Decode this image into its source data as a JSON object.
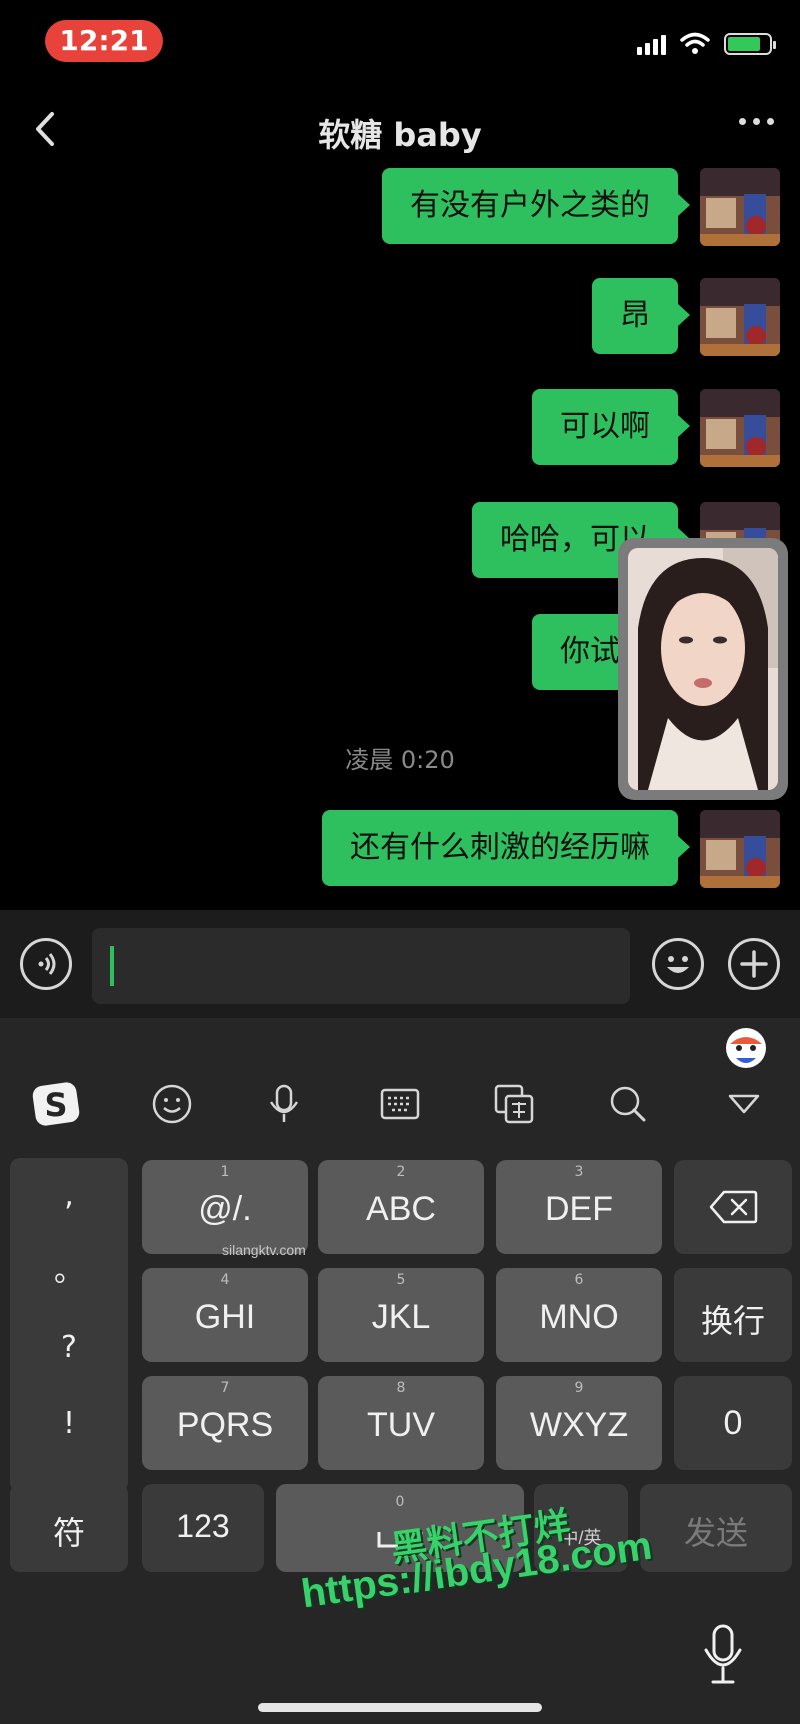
{
  "status_bar": {
    "time": "12:21"
  },
  "nav": {
    "title": "软糖 baby"
  },
  "messages": [
    {
      "text": "有没有户外之类的"
    },
    {
      "text": "昂"
    },
    {
      "text": "可以啊"
    },
    {
      "text": "哈哈，可以"
    },
    {
      "text": "你试过"
    },
    {
      "text": "还有什么刺激的经历嘛"
    }
  ],
  "timestamp": "凌晨 0:20",
  "input": {
    "value": ""
  },
  "keyboard": {
    "punctuation": [
      ",",
      "。",
      "?",
      "!"
    ],
    "keys_row1": [
      {
        "num": "1",
        "label": "@/."
      },
      {
        "num": "2",
        "label": "ABC"
      },
      {
        "num": "3",
        "label": "DEF"
      }
    ],
    "keys_row2": [
      {
        "num": "4",
        "label": "GHI"
      },
      {
        "num": "5",
        "label": "JKL"
      },
      {
        "num": "6",
        "label": "MNO"
      }
    ],
    "keys_row3": [
      {
        "num": "7",
        "label": "PQRS"
      },
      {
        "num": "8",
        "label": "TUV"
      },
      {
        "num": "9",
        "label": "WXYZ"
      }
    ],
    "newline_label": "换行",
    "zero_label": "0",
    "symbol_label": "符",
    "numeric_label": "123",
    "space_num": "0",
    "lang_label": "中/英",
    "send_label": "发送"
  },
  "watermarks": {
    "small": "silangktv.com",
    "line1": "黑料不打烊",
    "line2": "https://ibdy18.com"
  },
  "colors": {
    "bubble": "#2ec05e",
    "accent": "#2ec05e",
    "time_pill": "#e8433a"
  }
}
